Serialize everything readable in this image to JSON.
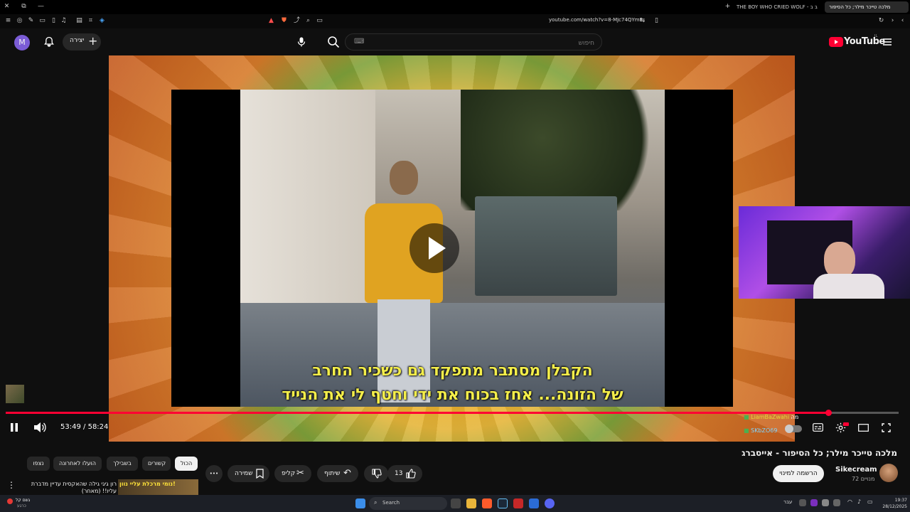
{
  "browser": {
    "tabs": [
      {
        "label": "מלכה טייכר מילר; כל הסיפור",
        "active": true
      },
      {
        "label": "THE BOY WHO CRIED WOLF - חושב ב",
        "active": false
      }
    ],
    "new_tab_label": "+",
    "url": "youtube.com/watch?v=8-MJc74QYm8"
  },
  "header": {
    "logo": "YouTube",
    "logo_sup": "IL",
    "search_placeholder": "חיפוש",
    "create_label": "יצירה",
    "avatar_letter": "M",
    "accent": "#ff0033"
  },
  "video": {
    "subtitle_line1": "הקבלן מסתבר מתפקד גם כשכיר החרב",
    "subtitle_line2": "של הזונה... אחז בכוח את ידי וחטף לי את הנייד",
    "time_current": "53:49",
    "time_total": "58:24",
    "time_sep": "/",
    "progress": 0.9214,
    "chat": [
      {
        "name": "LiamBaZwahi",
        "text": "מה"
      },
      {
        "name": "SKbZO69",
        "text": ""
      }
    ]
  },
  "below": {
    "title": "מלכה טייכר מילר; כל הסיפור - אייסברג",
    "channel": "Sikecream",
    "subscribers": "72 מנויים",
    "subscribe_label": "הרשמה למינוי",
    "likes": "13",
    "share_label": "שיתוף",
    "clip_label": "קליפ",
    "save_label": "שמירה",
    "more_label": "•••",
    "chips": [
      {
        "label": "הכול",
        "selected": true
      },
      {
        "label": "קשורים",
        "selected": false
      },
      {
        "label": "בשבילך",
        "selected": false
      },
      {
        "label": "הועלו לאחרונה",
        "selected": false
      },
      {
        "label": "נצפו",
        "selected": false
      }
    ],
    "rec_title": "רון גיגי גילה שהאקסית עדיין מדברת עליו!! (מאחר)",
    "rec_thumb_text": "נומי מרכלת עליי נוון!"
  },
  "taskbar": {
    "weather_temp": "גשם קל",
    "weather_sub": "כרגע",
    "search_label": "Search",
    "clock_time": "19:37",
    "clock_date": "28/12/2025",
    "lang": "עבר"
  }
}
